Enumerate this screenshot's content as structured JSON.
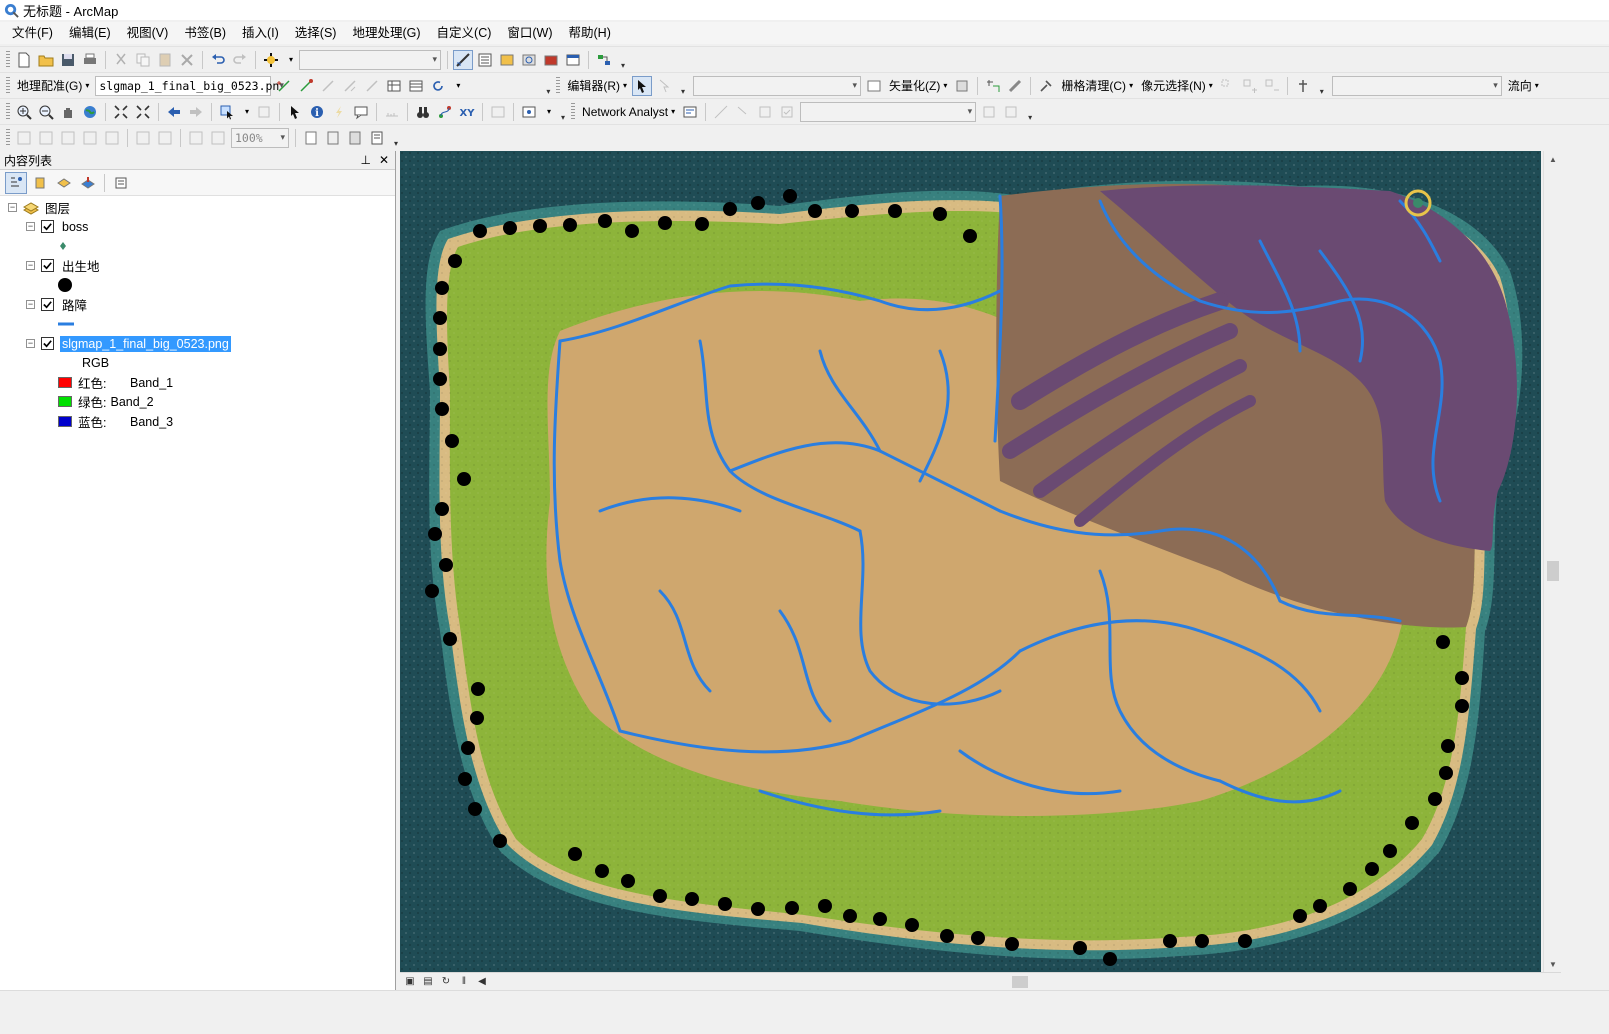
{
  "window": {
    "title": "无标题 - ArcMap"
  },
  "menu": [
    "文件(F)",
    "编辑(E)",
    "视图(V)",
    "书签(B)",
    "插入(I)",
    "选择(S)",
    "地理处理(G)",
    "自定义(C)",
    "窗口(W)",
    "帮助(H)"
  ],
  "toolbar2": {
    "georef_label": "地理配准(G)",
    "layer_combo": "slgmap_1_final_big_0523.pn",
    "editor_label": "编辑器(R)",
    "vectorize_label": "矢量化(Z)",
    "raster_cleanup_label": "栅格清理(C)",
    "cell_select_label": "像元选择(N)",
    "flow_label": "流向"
  },
  "toolbar3": {
    "network_analyst_label": "Network Analyst"
  },
  "toolbar4": {
    "zoom_value": "100%"
  },
  "toc": {
    "title": "内容列表",
    "root": "图层",
    "layers": [
      {
        "name": "boss",
        "checked": true
      },
      {
        "name": "出生地",
        "checked": true
      },
      {
        "name": "路障",
        "checked": true
      },
      {
        "name": "slgmap_1_final_big_0523.png",
        "checked": true,
        "selected": true
      }
    ],
    "raster_legend": {
      "type_label": "RGB",
      "bands": [
        {
          "label": "红色:",
          "band": "Band_1",
          "color": "#ff0000"
        },
        {
          "label": "绿色:",
          "band": "Band_2",
          "color": "#00e000"
        },
        {
          "label": "蓝色:",
          "band": "Band_3",
          "color": "#0000cc"
        }
      ]
    }
  },
  "colors": {
    "ocean": "#1f4c55",
    "grass": "#8db43a",
    "desert": "#cfa76e",
    "mountain": "#8c6c55",
    "volcanic": "#6a4a72",
    "river": "#2a7ee0",
    "spawn_point": "#000000",
    "selection": "#3399ff"
  }
}
